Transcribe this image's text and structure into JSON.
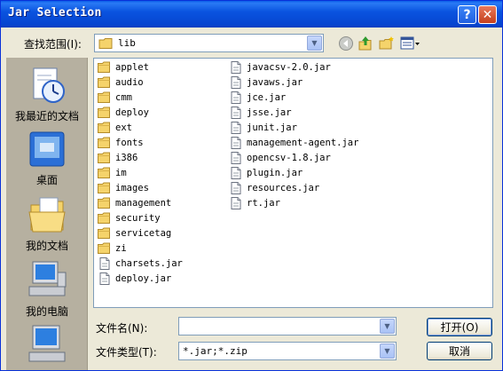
{
  "window": {
    "title": "Jar Selection",
    "help_glyph": "?",
    "close_glyph": "✕"
  },
  "lookin": {
    "label": "查找范围(I):",
    "value": "lib"
  },
  "toolbar": {
    "icons": [
      "back-icon",
      "up-folder-icon",
      "new-folder-icon",
      "views-menu-icon"
    ]
  },
  "places": [
    {
      "label": "我最近的文档",
      "icon": "recent-documents-icon"
    },
    {
      "label": "桌面",
      "icon": "desktop-icon"
    },
    {
      "label": "我的文档",
      "icon": "my-documents-icon"
    },
    {
      "label": "我的电脑",
      "icon": "my-computer-icon"
    },
    {
      "label": "",
      "icon": "network-places-icon"
    }
  ],
  "files": {
    "col1": [
      {
        "name": "applet",
        "type": "folder"
      },
      {
        "name": "audio",
        "type": "folder"
      },
      {
        "name": "cmm",
        "type": "folder"
      },
      {
        "name": "deploy",
        "type": "folder"
      },
      {
        "name": "ext",
        "type": "folder"
      },
      {
        "name": "fonts",
        "type": "folder"
      },
      {
        "name": "i386",
        "type": "folder"
      },
      {
        "name": "im",
        "type": "folder"
      },
      {
        "name": "images",
        "type": "folder"
      },
      {
        "name": "management",
        "type": "folder"
      },
      {
        "name": "security",
        "type": "folder"
      },
      {
        "name": "servicetag",
        "type": "folder"
      },
      {
        "name": "zi",
        "type": "folder"
      },
      {
        "name": "charsets.jar",
        "type": "file"
      },
      {
        "name": "deploy.jar",
        "type": "file"
      }
    ],
    "col2": [
      {
        "name": "javacsv-2.0.jar",
        "type": "file"
      },
      {
        "name": "javaws.jar",
        "type": "file"
      },
      {
        "name": "jce.jar",
        "type": "file"
      },
      {
        "name": "jsse.jar",
        "type": "file"
      },
      {
        "name": "junit.jar",
        "type": "file"
      },
      {
        "name": "management-agent.jar",
        "type": "file"
      },
      {
        "name": "opencsv-1.8.jar",
        "type": "file"
      },
      {
        "name": "plugin.jar",
        "type": "file"
      },
      {
        "name": "resources.jar",
        "type": "file"
      },
      {
        "name": "rt.jar",
        "type": "file"
      }
    ]
  },
  "filename": {
    "label": "文件名(N):",
    "value": ""
  },
  "filetype": {
    "label": "文件类型(T):",
    "value": "*.jar;*.zip"
  },
  "buttons": {
    "open": "打开(O)",
    "cancel": "取消"
  },
  "colors": {
    "titlebar": "#0a54e0",
    "dialog_bg": "#ece9d8",
    "places_bg": "#b6b0a0",
    "folder": "#f5d36b"
  }
}
